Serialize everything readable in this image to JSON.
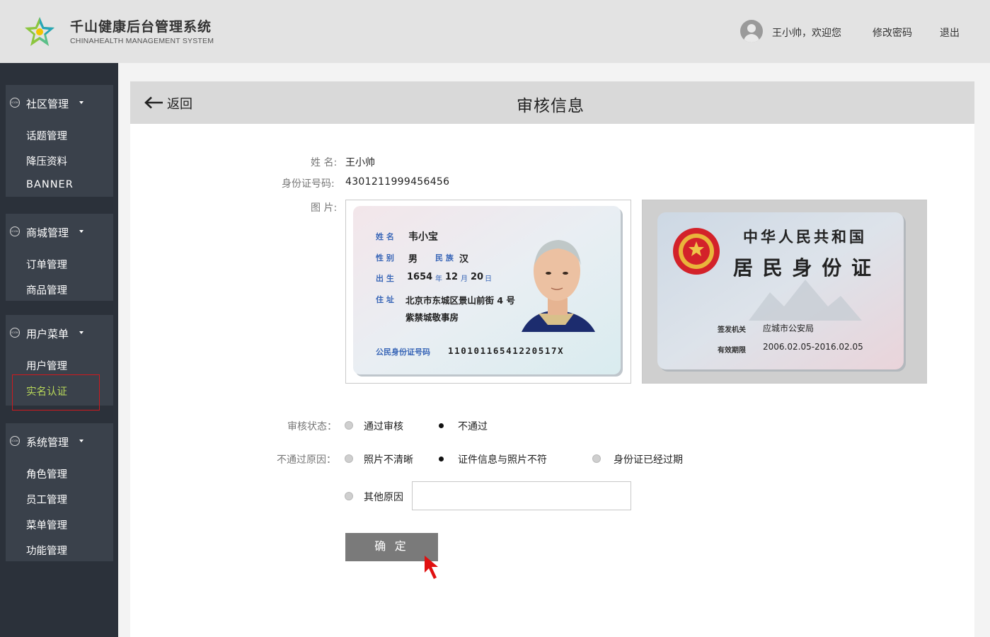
{
  "header": {
    "title": "千山健康后台管理系统",
    "subtitle": "CHINAHEALTH  MANAGEMENT SYSTEM",
    "user_greeting": "王小帅，欢迎您",
    "change_password": "修改密码",
    "logout": "退出",
    "avatar_icon": "user-avatar-icon",
    "logo_icon": "star-logo-icon"
  },
  "sidebar": {
    "groups": [
      {
        "label": "社区管理",
        "icon": "ICON",
        "items": [
          "话题管理",
          "降压资料",
          "BANNER"
        ]
      },
      {
        "label": "商城管理",
        "icon": "ICON",
        "items": [
          "订单管理",
          "商品管理"
        ]
      },
      {
        "label": "用户菜单",
        "icon": "ICON",
        "items": [
          "用户管理",
          "实名认证"
        ]
      },
      {
        "label": "系统管理",
        "icon": "ICON",
        "items": [
          "角色管理",
          "员工管理",
          "菜单管理",
          "功能管理"
        ]
      }
    ],
    "active_item": "实名认证",
    "active_color": "#b7d65a",
    "highlight_border_color": "#d0191e"
  },
  "panel": {
    "back_label": "返回",
    "title": "审核信息",
    "fields": {
      "name_label": "姓 名:",
      "name_value": "王小帅",
      "id_label": "身份证号码:",
      "id_value": "4301211999456456",
      "image_label": "图 片:"
    },
    "id_card_front": {
      "name_key": "姓 名",
      "name": "韦小宝",
      "sex_key": "性 别",
      "sex": "男",
      "ethnic_key": "民 族",
      "ethnic": "汉",
      "birth_key": "出 生",
      "birth_year": "1654",
      "year_unit": "年",
      "birth_month": "12",
      "month_unit": "月",
      "birth_day": "20",
      "day_unit": "日",
      "address_key": "住 址",
      "address_line1": "北京市东城区景山前街 4 号",
      "address_line2": "紫禁城敬事房",
      "id_key": "公民身份证号码",
      "id_number": "11010116541220517X"
    },
    "id_card_back": {
      "country": "中华人民共和国",
      "card_type": "居 民 身 份 证",
      "authority_key": "签发机关",
      "authority": "应城市公安局",
      "validity_key": "有效期限",
      "validity": "2006.02.05-2016.02.05"
    },
    "review_status": {
      "label": "审核状态：",
      "options": [
        {
          "label": "通过审核",
          "checked": false
        },
        {
          "label": "不通过",
          "checked": true
        }
      ]
    },
    "reject_reason": {
      "label": "不通过原因：",
      "options": [
        {
          "label": "照片不清晰",
          "checked": false
        },
        {
          "label": "证件信息与照片不符",
          "checked": true
        },
        {
          "label": "身份证已经过期",
          "checked": false
        },
        {
          "label": "其他原因",
          "checked": false
        }
      ],
      "other_input_value": ""
    },
    "confirm_label": "确 定"
  },
  "colors": {
    "header_bg": "#e3e3e3",
    "sidebar_bg": "#2b313a",
    "menu_group_bg": "#3a414b",
    "panel_head_bg": "#d9d9d9",
    "button_bg": "#7a7a7a",
    "cursor": "#e01010"
  }
}
